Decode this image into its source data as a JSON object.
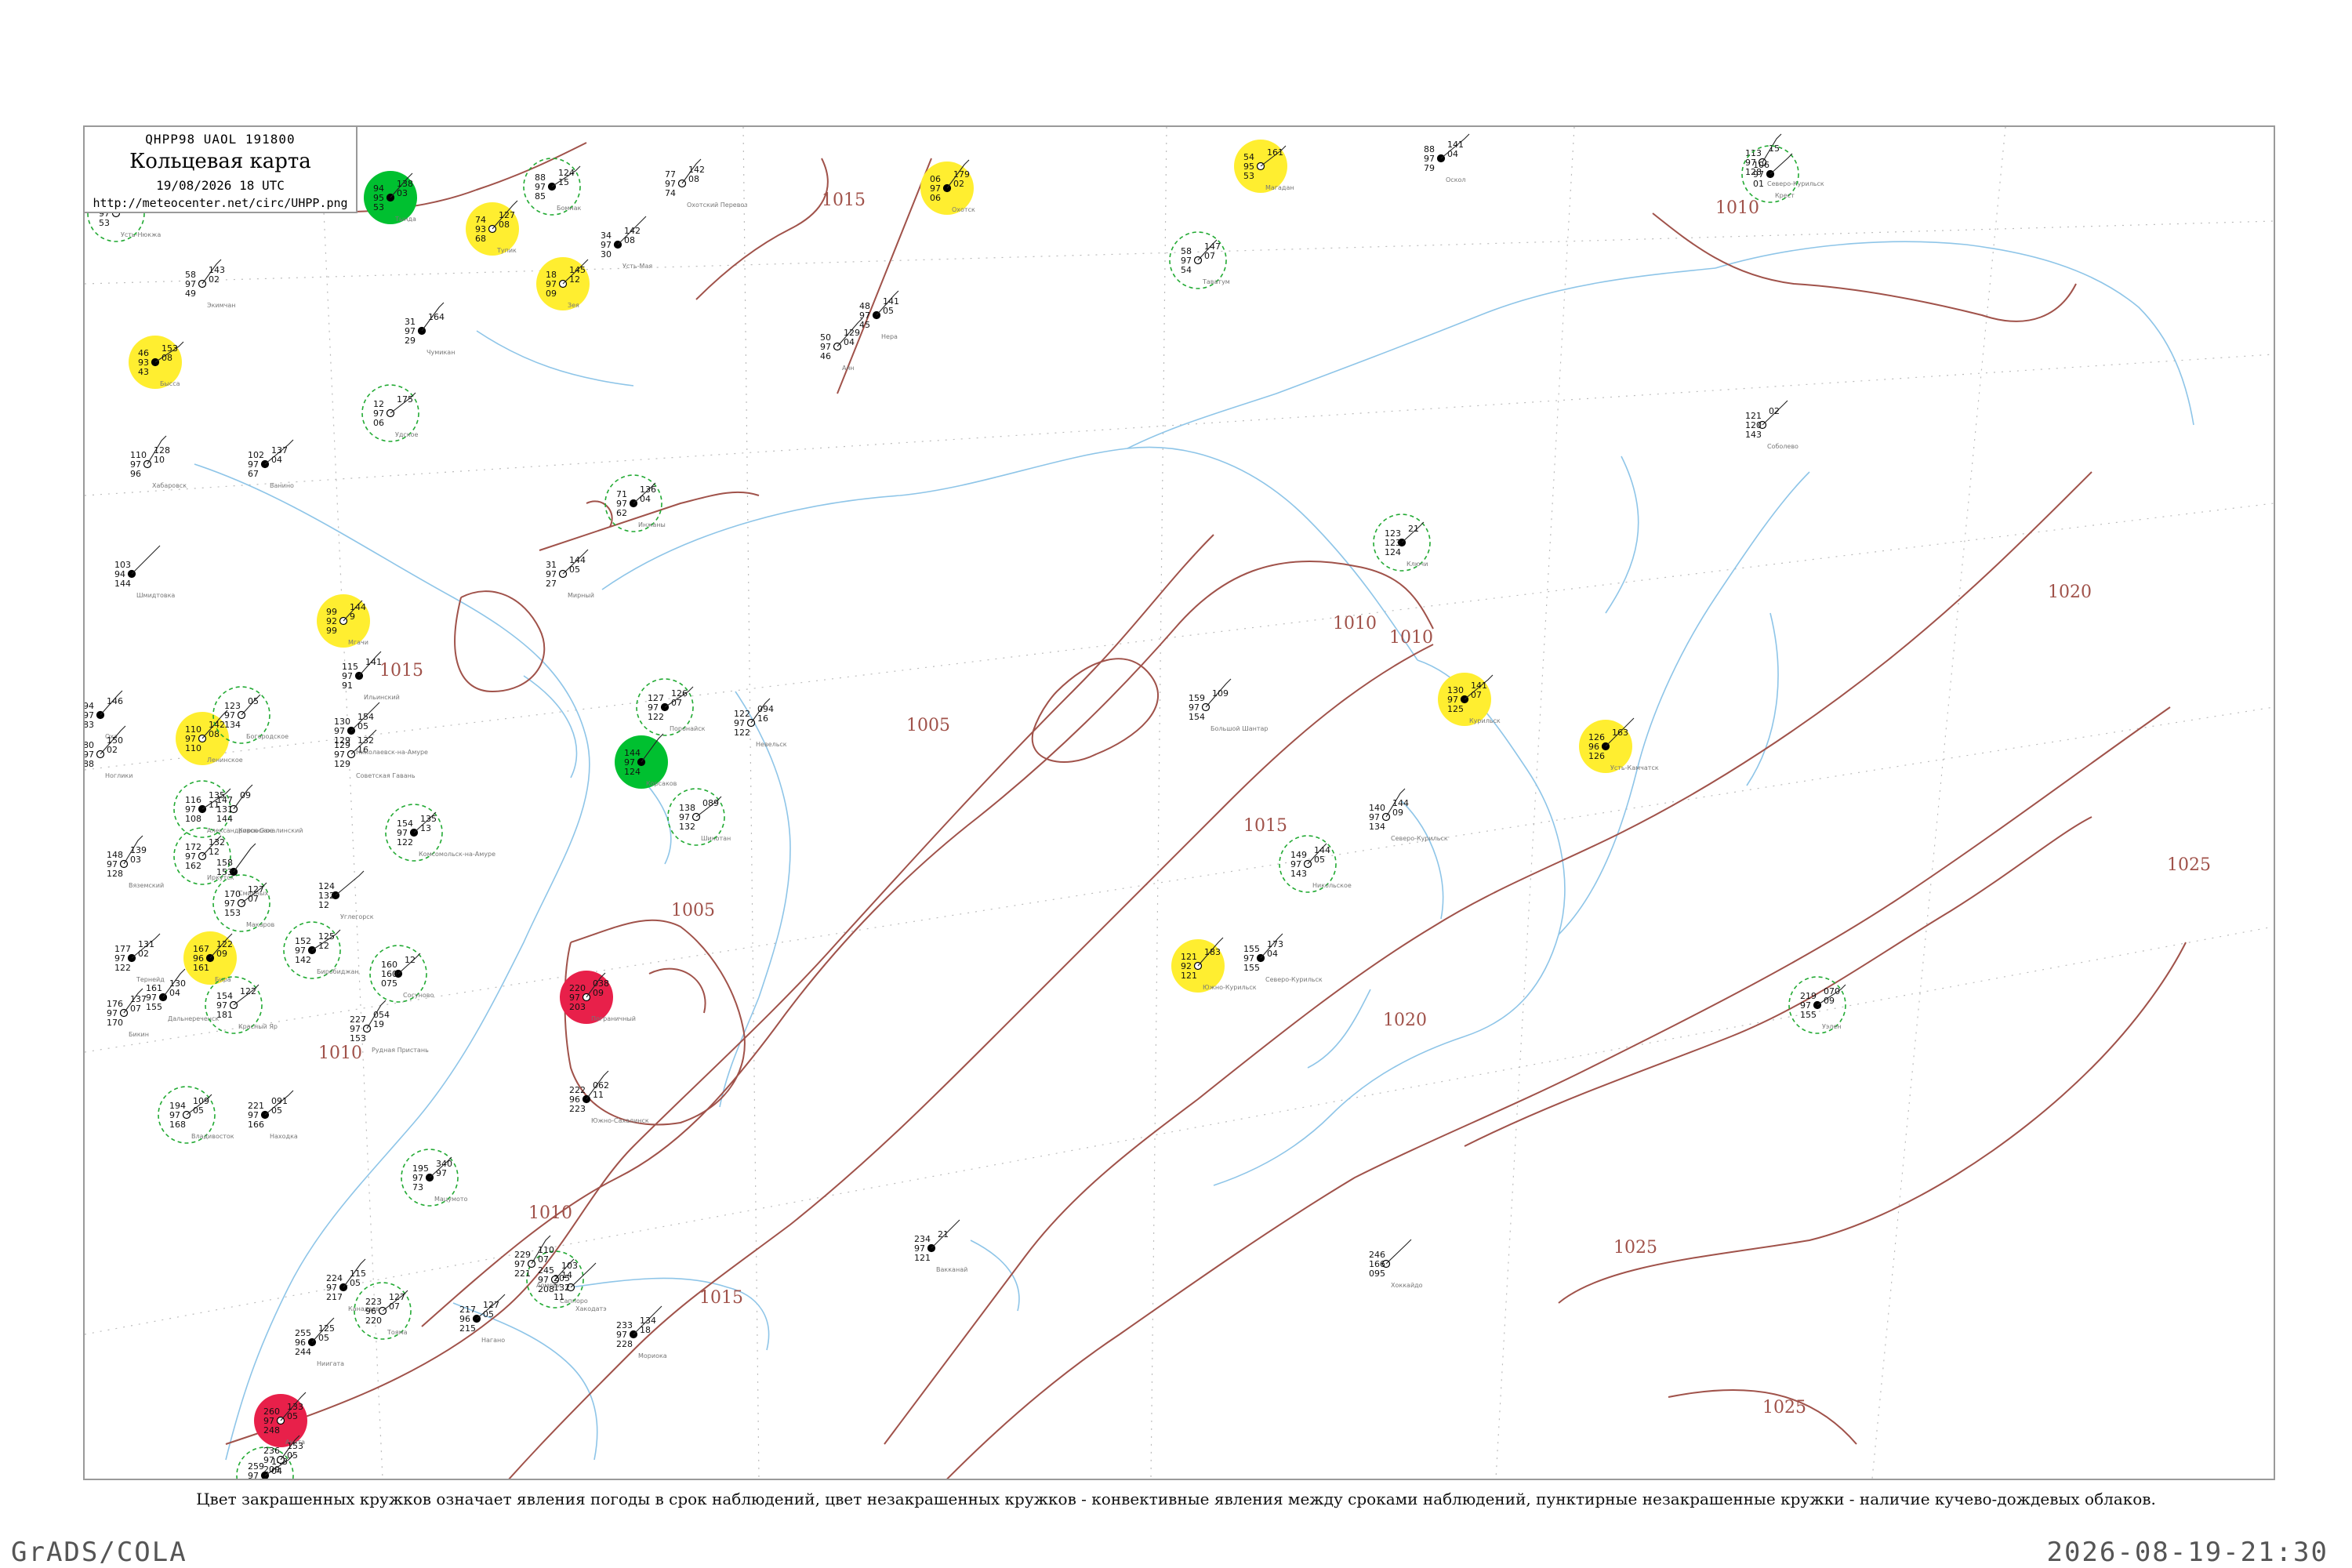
{
  "header": {
    "code": "QHPP98  UAOL  191800",
    "title": "Кольцевая карта",
    "time": "19/08/2026 18 UTC",
    "url": "http://meteocenter.net/circ/UHPP.png"
  },
  "caption": "Цвет закрашенных кружков означает явления погоды в срок наблюдений, цвет незакрашенных кружков - конвективные явления между сроками наблюдений, пунктирные незакрашенные кружки - наличие кучево-дождевых облаков.",
  "footer": {
    "left": "GrADS/COLA",
    "right": "2026-08-19-21:30"
  },
  "colors": {
    "isobar": "#a0524a",
    "coast": "#8ec5e8",
    "rain": "#00c030",
    "shower_outline": "#22aa33",
    "fog": "#ffee30",
    "thunder": "#e8204a",
    "grid": "#bbbbbb"
  },
  "isobars": [
    {
      "label": "1005"
    },
    {
      "label": "1010"
    },
    {
      "label": "1010"
    },
    {
      "label": "1010"
    },
    {
      "label": "1010"
    },
    {
      "label": "1010"
    },
    {
      "label": "1015"
    },
    {
      "label": "1015"
    },
    {
      "label": "1015"
    },
    {
      "label": "1015"
    },
    {
      "label": "1020"
    },
    {
      "label": "1020"
    },
    {
      "label": "1025"
    },
    {
      "label": "1025"
    },
    {
      "label": "1025"
    },
    {
      "label": "1005"
    }
  ],
  "stations": [
    {
      "id": "st-1",
      "name": "Усть-Нюкжа",
      "values": [
        "67",
        "97",
        "53",
        "141",
        "05"
      ],
      "fill": "none"
    },
    {
      "id": "st-2",
      "name": "Тында",
      "values": [
        "94",
        "95",
        "53",
        "138",
        "03"
      ],
      "fill": "rain"
    },
    {
      "id": "st-3",
      "name": "Тупик",
      "values": [
        "74",
        "93",
        "68",
        "127",
        "08"
      ],
      "fill": "fog"
    },
    {
      "id": "st-4",
      "name": "Бомнак",
      "values": [
        "88",
        "97",
        "85",
        "124",
        "15"
      ],
      "fill": "none"
    },
    {
      "id": "st-5",
      "name": "Охотский Перевоз",
      "values": [
        "77",
        "97",
        "74",
        "142",
        "08"
      ],
      "fill": "none"
    },
    {
      "id": "st-6",
      "name": "Охотск",
      "values": [
        "06",
        "97",
        "06",
        "179",
        "02"
      ],
      "fill": "fog"
    },
    {
      "id": "st-7",
      "name": "Магадан",
      "values": [
        "54",
        "95",
        "53",
        "161"
      ],
      "fill": "fog"
    },
    {
      "id": "st-8",
      "name": "Оскол",
      "values": [
        "88",
        "97",
        "79",
        "141",
        "04"
      ],
      "fill": "none"
    },
    {
      "id": "st-9",
      "name": "Северо-Курильск",
      "values": [
        "113",
        "97",
        "128",
        "15"
      ],
      "fill": "none"
    },
    {
      "id": "st-10",
      "name": "Крест",
      "values": [
        "106",
        "97",
        "01"
      ],
      "fill": "none"
    },
    {
      "id": "st-11",
      "name": "Зея",
      "values": [
        "18",
        "97",
        "09",
        "145",
        "12"
      ],
      "fill": "fog"
    },
    {
      "id": "st-12",
      "name": "Усть-Мая",
      "values": [
        "34",
        "97",
        "30",
        "142",
        "08"
      ],
      "fill": "none"
    },
    {
      "id": "st-13",
      "name": "Таватум",
      "values": [
        "58",
        "97",
        "54",
        "147",
        "07"
      ],
      "fill": "none"
    },
    {
      "id": "st-14",
      "name": "Нера",
      "values": [
        "48",
        "97",
        "45",
        "141",
        "05"
      ],
      "fill": "none"
    },
    {
      "id": "st-15",
      "name": "Аян",
      "values": [
        "50",
        "97",
        "46",
        "129",
        "04"
      ],
      "fill": "none"
    },
    {
      "id": "st-16",
      "name": "Бысса",
      "values": [
        "46",
        "93",
        "43",
        "153",
        "08"
      ],
      "fill": "fog"
    },
    {
      "id": "st-17",
      "name": "Экимчан",
      "values": [
        "58",
        "97",
        "49",
        "143",
        "02"
      ],
      "fill": "none"
    },
    {
      "id": "st-18",
      "name": "Чумикан",
      "values": [
        "31",
        "97",
        "29",
        "164"
      ],
      "fill": "none"
    },
    {
      "id": "st-19",
      "name": "Удское",
      "values": [
        "12",
        "97",
        "06",
        "175"
      ],
      "fill": "none"
    },
    {
      "id": "st-20",
      "name": "Ванино",
      "values": [
        "102",
        "97",
        "67",
        "137",
        "04"
      ],
      "fill": "none"
    },
    {
      "id": "st-21",
      "name": "Хабаровск",
      "values": [
        "110",
        "97",
        "96",
        "128",
        "10"
      ],
      "fill": "none"
    },
    {
      "id": "st-22",
      "name": "Инжаны",
      "values": [
        "71",
        "97",
        "62",
        "136",
        "04"
      ],
      "fill": "none"
    },
    {
      "id": "st-23",
      "name": "Мирный",
      "values": [
        "31",
        "97",
        "27",
        "144",
        "05"
      ],
      "fill": "none"
    },
    {
      "id": "st-24",
      "name": "Шмидтовка",
      "values": [
        "103",
        "94",
        "144"
      ],
      "fill": "none"
    },
    {
      "id": "st-25",
      "name": "Мгачи",
      "values": [
        "99",
        "92",
        "99",
        "144",
        "9"
      ],
      "fill": "fog"
    },
    {
      "id": "st-26",
      "name": "Ильинский",
      "values": [
        "115",
        "97",
        "91",
        "141"
      ],
      "fill": "none"
    },
    {
      "id": "st-27",
      "name": "Большой Шантар",
      "values": [
        "159",
        "97",
        "154",
        "109"
      ],
      "fill": "none"
    },
    {
      "id": "st-28",
      "name": "Поронайск",
      "values": [
        "127",
        "97",
        "122",
        "126",
        "07"
      ],
      "fill": "none"
    },
    {
      "id": "st-29",
      "name": "Невельск",
      "values": [
        "122",
        "97",
        "122",
        "094",
        "16"
      ],
      "fill": "none"
    },
    {
      "id": "st-30",
      "name": "Корсаков",
      "values": [
        "144",
        "97",
        "124"
      ],
      "fill": "rain"
    },
    {
      "id": "st-31",
      "name": "Шикотан",
      "values": [
        "138",
        "97",
        "132",
        "089"
      ],
      "fill": "none"
    },
    {
      "id": "st-32",
      "name": "Курильск",
      "values": [
        "130",
        "97",
        "125",
        "141",
        "07"
      ],
      "fill": "fog"
    },
    {
      "id": "st-33",
      "name": "Северо-Курильск",
      "values": [
        "140",
        "97",
        "134",
        "144",
        "09"
      ],
      "fill": "none"
    },
    {
      "id": "st-34",
      "name": "Ключи",
      "values": [
        "123",
        "123",
        "124",
        "21"
      ],
      "fill": "none"
    },
    {
      "id": "st-35",
      "name": "Соболево",
      "values": [
        "121",
        "120",
        "143",
        "02"
      ],
      "fill": "none"
    },
    {
      "id": "st-36",
      "name": "Усть-Камчатск",
      "values": [
        "126",
        "96",
        "126",
        "163"
      ],
      "fill": "fog"
    },
    {
      "id": "st-37",
      "name": "Никольское",
      "values": [
        "149",
        "97",
        "143",
        "144",
        "05"
      ],
      "fill": "none"
    },
    {
      "id": "st-38",
      "name": "Северо-Курильск",
      "values": [
        "155",
        "97",
        "155",
        "173",
        "04"
      ],
      "fill": "none"
    },
    {
      "id": "st-39",
      "name": "Южно-Курильск",
      "values": [
        "121",
        "92",
        "121",
        "183"
      ],
      "fill": "fog"
    },
    {
      "id": "st-40",
      "name": "Уэлен",
      "values": [
        "219",
        "97",
        "155",
        "070",
        "09"
      ],
      "fill": "none"
    },
    {
      "id": "st-41",
      "name": "Пограничный",
      "values": [
        "220",
        "97",
        "203",
        "038",
        "09"
      ],
      "fill": "thunder"
    },
    {
      "id": "st-42",
      "name": "Южно-Сахалинск",
      "values": [
        "222",
        "96",
        "223",
        "062",
        "11"
      ],
      "fill": "none"
    },
    {
      "id": "st-43",
      "name": "Владивосток",
      "values": [
        "194",
        "97",
        "168",
        "109",
        "05"
      ],
      "fill": "none"
    },
    {
      "id": "st-44",
      "name": "Находка",
      "values": [
        "221",
        "97",
        "166",
        "091",
        "05"
      ],
      "fill": "none"
    },
    {
      "id": "st-45",
      "name": "Рудная Пристань",
      "values": [
        "227",
        "97",
        "153",
        "054",
        "19"
      ],
      "fill": "none"
    },
    {
      "id": "st-46",
      "name": "Сосуново",
      "values": [
        "160",
        "160",
        "075",
        "12"
      ],
      "fill": "none"
    },
    {
      "id": "st-47",
      "name": "Хоккайдо",
      "values": [
        "246",
        "166",
        "095"
      ],
      "fill": "none"
    },
    {
      "id": "st-48",
      "name": "Вакканай",
      "values": [
        "234",
        "97",
        "121",
        "21"
      ],
      "fill": "none"
    },
    {
      "id": "st-49",
      "name": "Саппоро",
      "values": [
        "245",
        "97",
        "208",
        "103",
        "14"
      ],
      "fill": "none"
    },
    {
      "id": "st-50",
      "name": "Ниигата",
      "values": [
        "255",
        "96",
        "244",
        "125",
        "05"
      ],
      "fill": "none"
    },
    {
      "id": "st-51",
      "name": "Акита",
      "values": [
        "260",
        "97",
        "248",
        "133",
        "05"
      ],
      "fill": "thunder"
    },
    {
      "id": "st-52",
      "name": "Сендай",
      "values": [
        "259",
        "97",
        "230",
        "143",
        "04"
      ],
      "fill": "none"
    },
    {
      "id": "st-53",
      "name": "Фукусима",
      "values": [
        "236",
        "97",
        "209",
        "153",
        "05"
      ],
      "fill": "none"
    },
    {
      "id": "st-54",
      "name": "Канадзава",
      "values": [
        "224",
        "97",
        "217",
        "115",
        "05"
      ],
      "fill": "none"
    },
    {
      "id": "st-55",
      "name": "Тояма",
      "values": [
        "223",
        "96",
        "220",
        "127",
        "07"
      ],
      "fill": "none"
    },
    {
      "id": "st-56",
      "name": "Нагано",
      "values": [
        "217",
        "96",
        "215",
        "127",
        "05"
      ],
      "fill": "none"
    },
    {
      "id": "st-57",
      "name": "Аомори",
      "values": [
        "229",
        "97",
        "221",
        "110",
        "07"
      ],
      "fill": "none"
    },
    {
      "id": "st-58",
      "name": "Мацумото",
      "values": [
        "195",
        "97",
        "73",
        "340",
        "97"
      ],
      "fill": "none"
    },
    {
      "id": "st-59",
      "name": "Хакодатэ",
      "values": [
        "205",
        "132",
        "11"
      ],
      "fill": "none"
    },
    {
      "id": "st-60",
      "name": "Мориока",
      "values": [
        "233",
        "97",
        "228",
        "134",
        "18"
      ],
      "fill": "none"
    },
    {
      "id": "st-61",
      "name": "Иркутск",
      "values": [
        "172",
        "97",
        "162",
        "132",
        "12"
      ],
      "fill": "none"
    },
    {
      "id": "st-62",
      "name": "Бира",
      "values": [
        "167",
        "96",
        "161",
        "122",
        "09"
      ],
      "fill": "fog"
    },
    {
      "id": "st-63",
      "name": "Ленинское",
      "values": [
        "110",
        "97",
        "110",
        "142",
        "08"
      ],
      "fill": "fog"
    },
    {
      "id": "st-64",
      "name": "Биробиджан",
      "values": [
        "152",
        "97",
        "142",
        "125",
        "12"
      ],
      "fill": "none"
    },
    {
      "id": "st-65",
      "name": "Бикин",
      "values": [
        "176",
        "97",
        "170",
        "137",
        "07"
      ],
      "fill": "none"
    },
    {
      "id": "st-66",
      "name": "Дальнереченск",
      "values": [
        "161",
        "97",
        "155",
        "130",
        "04"
      ],
      "fill": "none"
    },
    {
      "id": "st-67",
      "name": "Красный Яр",
      "values": [
        "154",
        "97",
        "181",
        "122"
      ],
      "fill": "none"
    },
    {
      "id": "st-68",
      "name": "Тернейд",
      "values": [
        "177",
        "97",
        "122",
        "131",
        "02"
      ],
      "fill": "none"
    },
    {
      "id": "st-69",
      "name": "Вяземский",
      "values": [
        "148",
        "97",
        "128",
        "139",
        "03"
      ],
      "fill": "none"
    },
    {
      "id": "st-70",
      "name": "Комсомольск-на-Амуре",
      "values": [
        "154",
        "97",
        "122",
        "135",
        "13"
      ],
      "fill": "none"
    },
    {
      "id": "st-71",
      "name": "Советская Гавань",
      "values": [
        "129",
        "97",
        "129",
        "132",
        "16"
      ],
      "fill": "none"
    },
    {
      "id": "st-72",
      "name": "Николаевск-на-Амуре",
      "values": [
        "130",
        "97",
        "129",
        "154",
        "05"
      ],
      "fill": "none"
    },
    {
      "id": "st-73",
      "name": "Богородское",
      "values": [
        "123",
        "97",
        "134",
        "05"
      ],
      "fill": "none"
    },
    {
      "id": "st-74",
      "name": "Оха",
      "values": [
        "94",
        "97",
        "83",
        "146"
      ],
      "fill": "none"
    },
    {
      "id": "st-75",
      "name": "Ноглики",
      "values": [
        "80",
        "97",
        "88",
        "150",
        "02"
      ],
      "fill": "none"
    },
    {
      "id": "st-76",
      "name": "Александровск-Сахалинский",
      "values": [
        "116",
        "97",
        "108",
        "135",
        "11"
      ],
      "fill": "none"
    },
    {
      "id": "st-77",
      "name": "Кировское",
      "values": [
        "147",
        "131",
        "144",
        "09"
      ],
      "fill": "none"
    },
    {
      "id": "st-78",
      "name": "Смирных",
      "values": [
        "158",
        "153"
      ],
      "fill": "none"
    },
    {
      "id": "st-79",
      "name": "Макаров",
      "values": [
        "170",
        "97",
        "153",
        "127",
        "07"
      ],
      "fill": "none"
    },
    {
      "id": "st-80",
      "name": "Углегорск",
      "values": [
        "124",
        "132",
        "12"
      ],
      "fill": "none"
    }
  ]
}
